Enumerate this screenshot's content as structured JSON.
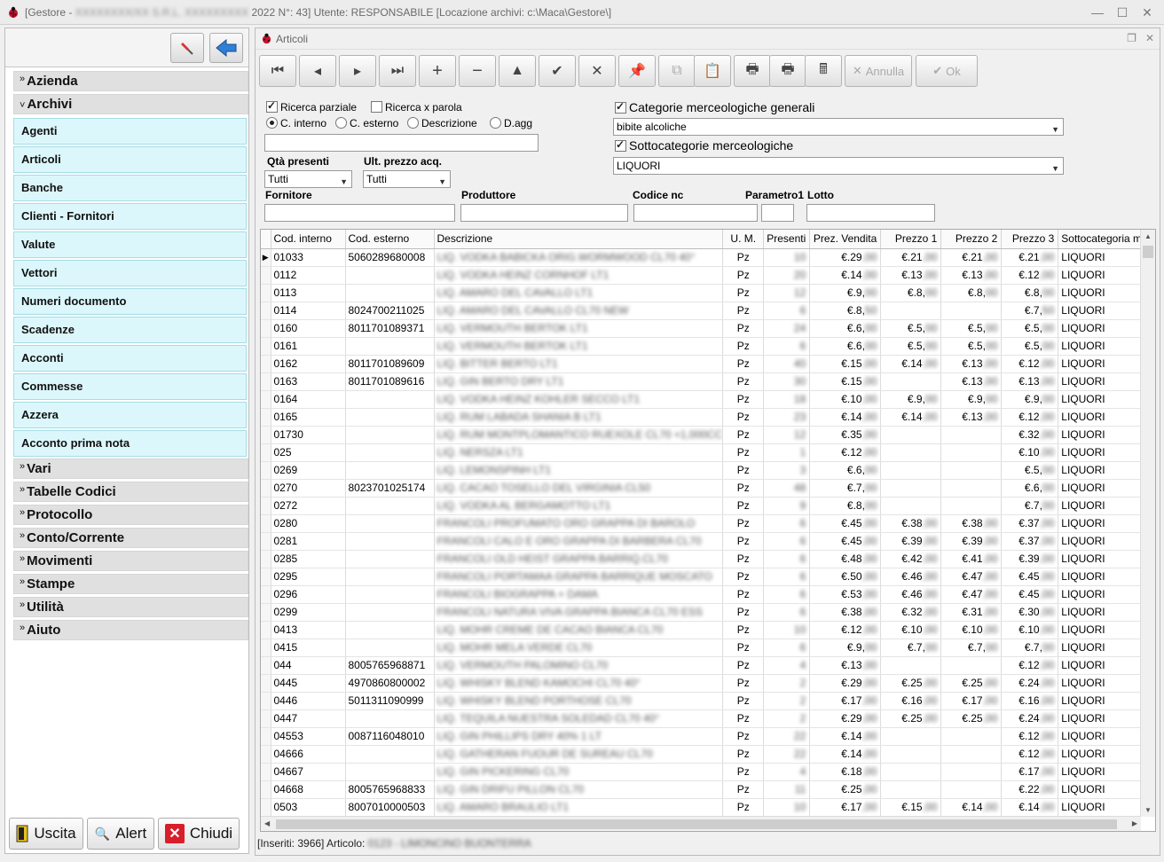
{
  "window": {
    "title_prefix": "[Gestore - ",
    "title_blurred": "XXXXXXXX/XX S.R.L. XXXXXXXXX",
    "title_suffix": " 2022 N°: 43]  Utente: RESPONSABILE  [Locazione archivi: c:\\Maca\\Gestore\\]"
  },
  "sidebar": {
    "sections": [
      {
        "label": "Azienda",
        "expanded": false
      },
      {
        "label": "Archivi",
        "expanded": true
      },
      {
        "label": "Vari",
        "expanded": false
      },
      {
        "label": "Tabelle Codici",
        "expanded": false
      },
      {
        "label": "Protocollo",
        "expanded": false
      },
      {
        "label": "Conto/Corrente",
        "expanded": false
      },
      {
        "label": "Movimenti",
        "expanded": false
      },
      {
        "label": "Stampe",
        "expanded": false
      },
      {
        "label": "Utilità",
        "expanded": false
      },
      {
        "label": "Aiuto",
        "expanded": false
      }
    ],
    "archivi_items": [
      "Agenti",
      "Articoli",
      "Banche",
      "Clienti - Fornitori",
      "Valute",
      "Vettori",
      "Numeri documento",
      "Scadenze",
      "Acconti",
      "Commesse",
      "Azzera",
      "Acconto prima nota"
    ],
    "buttons": {
      "exit": "Uscita",
      "alert": "Alert",
      "close": "Chiudi"
    }
  },
  "panel": {
    "title": "Articoli",
    "toolbar": {
      "cancel": "Annulla",
      "ok": "Ok"
    },
    "filters": {
      "partial_search": "Ricerca parziale",
      "word_search": "Ricerca x parola",
      "radio": [
        "C. interno",
        "C. esterno",
        "Descrizione",
        "D.agg"
      ],
      "search_value": "",
      "qty_label": "Qtà presenti",
      "qty_value": "Tutti",
      "lastprice_label": "Ult. prezzo acq.",
      "lastprice_value": "Tutti",
      "supplier_label": "Fornitore",
      "producer_label": "Produttore",
      "nc_label": "Codice nc",
      "param_label": "Parametro1",
      "lot_label": "Lotto",
      "cat_label": "Categorie merceologiche generali",
      "cat_value": "bibite alcoliche",
      "subcat_label": "Sottocategorie merceologiche",
      "subcat_value": "LIQUORI"
    },
    "columns": [
      "Cod. interno",
      "Cod. esterno",
      "Descrizione",
      "U. M.",
      "Presenti",
      "Prez. Vendita",
      "Prezzo 1",
      "Prezzo 2",
      "Prezzo 3",
      "Sottocategoria me"
    ],
    "rows": [
      [
        "01033",
        "5060289680008",
        "LIQ. VODKA BABICKA ORIG.WORMWOOD CL70 40°",
        "Pz",
        "10",
        "€.29,00",
        "€.21,00",
        "€.21,00",
        "€.21,00",
        "LIQUORI"
      ],
      [
        "0112",
        "",
        "LIQ. VODKA HEINZ CORNHOF LT1",
        "Pz",
        "20",
        "€.14,00",
        "€.13,00",
        "€.13,00",
        "€.12,00",
        "LIQUORI"
      ],
      [
        "0113",
        "",
        "LIQ. AMARO DEL CAVALLO LT1",
        "Pz",
        "12",
        "€.9,00",
        "€.8,00",
        "€.8,00",
        "€.8,00",
        "LIQUORI"
      ],
      [
        "0114",
        "8024700211025",
        "LIQ. AMARO DEL CAVALLO CL70 NEW",
        "Pz",
        "6",
        "€.8,50",
        "",
        "",
        "€.7,50",
        "LIQUORI"
      ],
      [
        "0160",
        "8011701089371",
        "LIQ. VERMOUTH BERTOK LT1",
        "Pz",
        "24",
        "€.6,00",
        "€.5,00",
        "€.5,00",
        "€.5,00",
        "LIQUORI"
      ],
      [
        "0161",
        "",
        "LIQ. VERMOUTH BERTOK LT1",
        "Pz",
        "6",
        "€.6,00",
        "€.5,00",
        "€.5,00",
        "€.5,00",
        "LIQUORI"
      ],
      [
        "0162",
        "8011701089609",
        "LIQ. BITTER BERTO LT1",
        "Pz",
        "40",
        "€.15,00",
        "€.14,00",
        "€.13,00",
        "€.12,00",
        "LIQUORI"
      ],
      [
        "0163",
        "8011701089616",
        "LIQ. GIN BERTO DRY LT1",
        "Pz",
        "30",
        "€.15,00",
        "",
        "€.13,00",
        "€.13,00",
        "LIQUORI"
      ],
      [
        "0164",
        "",
        "LIQ. VODKA HEINZ KOHLER SECCO LT1",
        "Pz",
        "18",
        "€.10,00",
        "€.9,00",
        "€.9,00",
        "€.9,00",
        "LIQUORI"
      ],
      [
        "0165",
        "",
        "LIQ. RUM LABADA SHANIA B LT1",
        "Pz",
        "23",
        "€.14,00",
        "€.14,00",
        "€.13,00",
        "€.12,00",
        "LIQUORI"
      ],
      [
        "01730",
        "",
        "LIQ. RUM MONTPLOMANTICO RUEXOLE CL70 +1,000CC",
        "Pz",
        "12",
        "€.35,00",
        "",
        "",
        "€.32,00",
        "LIQUORI"
      ],
      [
        "025",
        "",
        "LIQ. NERSZA LT1",
        "Pz",
        "1",
        "€.12,00",
        "",
        "",
        "€.10,00",
        "LIQUORI"
      ],
      [
        "0269",
        "",
        "LIQ. LEMONSPINH LT1",
        "Pz",
        "3",
        "€.6,00",
        "",
        "",
        "€.5,00",
        "LIQUORI"
      ],
      [
        "0270",
        "8023701025174",
        "LIQ. CACAO TOSELLO DEL VIRGINIA CL50",
        "Pz",
        "48",
        "€.7,00",
        "",
        "",
        "€.6,00",
        "LIQUORI"
      ],
      [
        "0272",
        "",
        "LIQ. VODKA AL BERGAMOTTO LT1",
        "Pz",
        "9",
        "€.8,00",
        "",
        "",
        "€.7,00",
        "LIQUORI"
      ],
      [
        "0280",
        "",
        "FRANCOLI PROFUMATO ORO GRAPPA DI BAROLO",
        "Pz",
        "6",
        "€.45,00",
        "€.38,00",
        "€.38,00",
        "€.37,00",
        "LIQUORI"
      ],
      [
        "0281",
        "",
        "FRANCOLI CALO E ORO GRAPPA DI BARBERA CL70",
        "Pz",
        "6",
        "€.45,00",
        "€.39,00",
        "€.39,00",
        "€.37,00",
        "LIQUORI"
      ],
      [
        "0285",
        "",
        "FRANCOLI OLD HEIST GRAPPA BARRIQ.CL70",
        "Pz",
        "6",
        "€.48,00",
        "€.42,00",
        "€.41,00",
        "€.39,00",
        "LIQUORI"
      ],
      [
        "0295",
        "",
        "FRANCOLI PORTAMAA GRAPPA BARRIQUE MOSCATO",
        "Pz",
        "6",
        "€.50,00",
        "€.46,00",
        "€.47,00",
        "€.45,00",
        "LIQUORI"
      ],
      [
        "0296",
        "",
        "FRANCOLI BIOGRAPPA + DAMA",
        "Pz",
        "6",
        "€.53,00",
        "€.46,00",
        "€.47,00",
        "€.45,00",
        "LIQUORI"
      ],
      [
        "0299",
        "",
        "FRANCOLI NATURA VIVA GRAPPA BIANCA CL70 ESS",
        "Pz",
        "6",
        "€.38,00",
        "€.32,00",
        "€.31,00",
        "€.30,00",
        "LIQUORI"
      ],
      [
        "0413",
        "",
        "LIQ. MOHR CREME DE CACAO BIANCA CL70",
        "Pz",
        "10",
        "€.12,00",
        "€.10,00",
        "€.10,00",
        "€.10,00",
        "LIQUORI"
      ],
      [
        "0415",
        "",
        "LIQ. MOHR MELA VERDE CL70",
        "Pz",
        "6",
        "€.9,00",
        "€.7,00",
        "€.7,00",
        "€.7,00",
        "LIQUORI"
      ],
      [
        "044",
        "8005765968871",
        "LIQ. VERMOUTH PALOMINO CL70",
        "Pz",
        "4",
        "€.13,00",
        "",
        "",
        "€.12,00",
        "LIQUORI"
      ],
      [
        "0445",
        "4970860800002",
        "LIQ. WHISKY BLEND KAMOCHI CL70 40°",
        "Pz",
        "2",
        "€.29,00",
        "€.25,00",
        "€.25,00",
        "€.24,00",
        "LIQUORI"
      ],
      [
        "0446",
        "5011311090999",
        "LIQ. WHISKY BLEND PORTHOSE CL70",
        "Pz",
        "2",
        "€.17,00",
        "€.16,00",
        "€.17,00",
        "€.16,00",
        "LIQUORI"
      ],
      [
        "0447",
        "",
        "LIQ. TEQUILA NUESTRA SOLEDAD CL70 40°",
        "Pz",
        "2",
        "€.29,00",
        "€.25,00",
        "€.25,00",
        "€.24,00",
        "LIQUORI"
      ],
      [
        "04553",
        "0087116048010",
        "LIQ. GIN PHILLIPS DRY 40% 1 LT",
        "Pz",
        "22",
        "€.14,00",
        "",
        "",
        "€.12,00",
        "LIQUORI"
      ],
      [
        "04666",
        "",
        "LIQ. GATHERAN FUOUR DE SUREAU CL70",
        "Pz",
        "22",
        "€.14,00",
        "",
        "",
        "€.12,00",
        "LIQUORI"
      ],
      [
        "04667",
        "",
        "LIQ. GIN PICKERING CL70",
        "Pz",
        "4",
        "€.18,00",
        "",
        "",
        "€.17,00",
        "LIQUORI"
      ],
      [
        "04668",
        "8005765968833",
        "LIQ. GIN DRIFU PILLON CL70",
        "Pz",
        "11",
        "€.25,00",
        "",
        "",
        "€.22,00",
        "LIQUORI"
      ],
      [
        "0503",
        "8007010000503",
        "LIQ. AMARO BRAULIO LT1",
        "Pz",
        "10",
        "€.17,00",
        "€.15,00",
        "€.14,00",
        "€.14,00",
        "LIQUORI"
      ]
    ],
    "status_prefix": "[Inseriti: 3966] Articolo: ",
    "status_blurred": "0123 - LIMONCINO BUONTERRA"
  }
}
